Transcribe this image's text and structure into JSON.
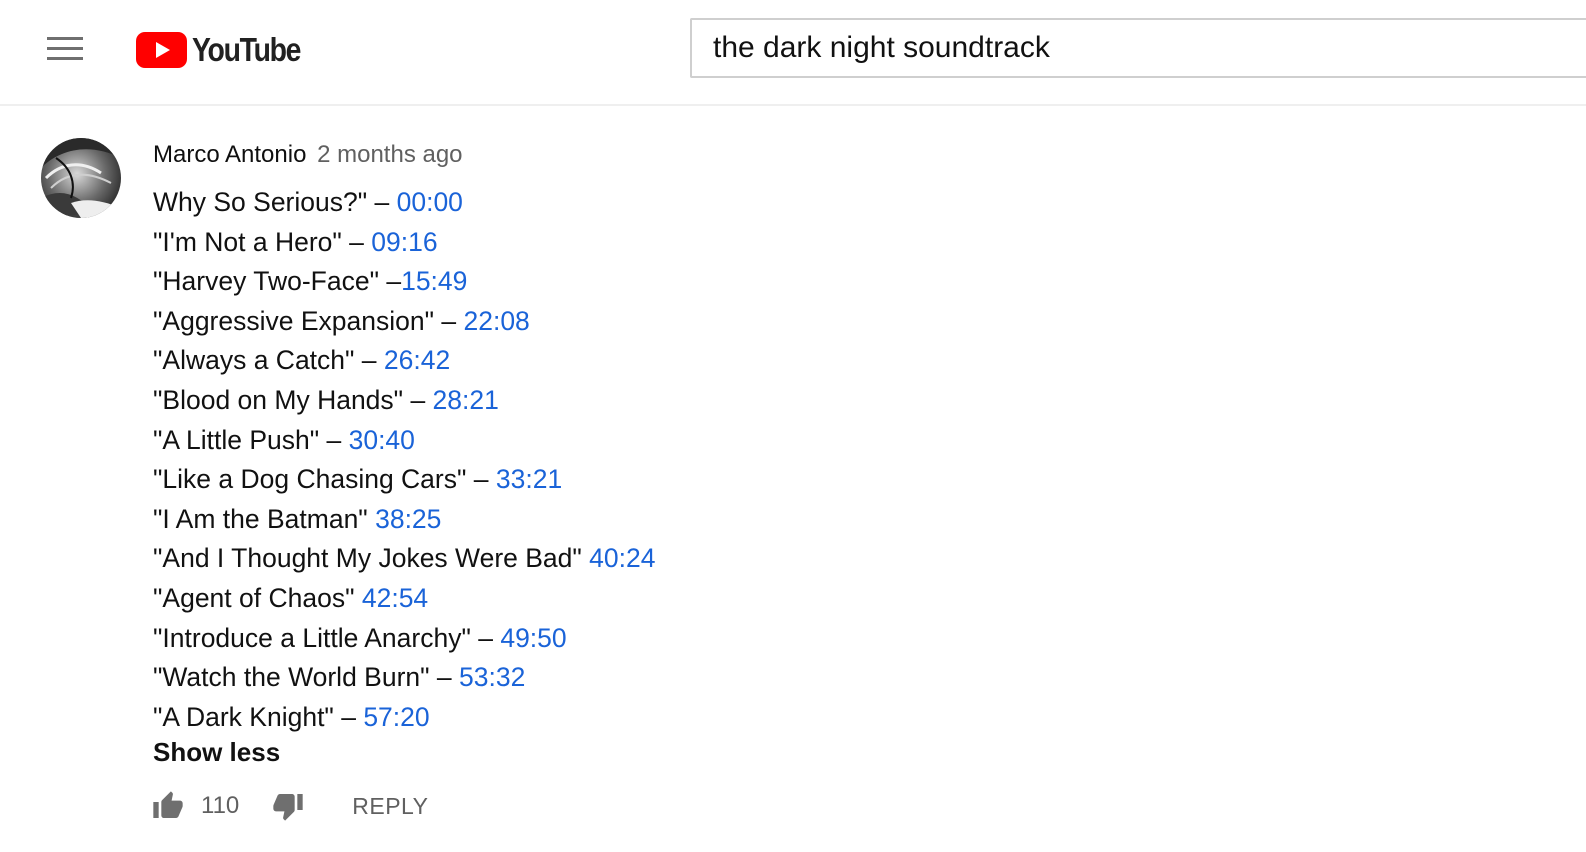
{
  "header": {
    "menu_icon": "hamburger-menu-icon",
    "logo_text": "YouTube",
    "brand_red": "#ff0000",
    "search_value": "the dark night soundtrack"
  },
  "comment": {
    "author": "Marco Antonio",
    "time": "2 months ago",
    "lines": [
      {
        "text": "Why So Serious?\" – ",
        "timestamp": "00:00"
      },
      {
        "text": "\"I'm Not a Hero\" – ",
        "timestamp": "09:16"
      },
      {
        "text": "\"Harvey Two-Face\" –",
        "timestamp": "15:49"
      },
      {
        "text": "\"Aggressive Expansion\" – ",
        "timestamp": "22:08"
      },
      {
        "text": "\"Always a Catch\" – ",
        "timestamp": "26:42"
      },
      {
        "text": "\"Blood on My Hands\" – ",
        "timestamp": "28:21"
      },
      {
        "text": "\"A Little Push\" – ",
        "timestamp": "30:40"
      },
      {
        "text": "\"Like a Dog Chasing Cars\" – ",
        "timestamp": "33:21"
      },
      {
        "text": "\"I Am the Batman\" ",
        "timestamp": "38:25"
      },
      {
        "text": "\"And I Thought My Jokes Were Bad\" ",
        "timestamp": "40:24"
      },
      {
        "text": "\"Agent of Chaos\" ",
        "timestamp": "42:54"
      },
      {
        "text": "\"Introduce a Little Anarchy\" – ",
        "timestamp": "49:50"
      },
      {
        "text": "\"Watch the World Burn\" – ",
        "timestamp": "53:32"
      },
      {
        "text": "\"A Dark Knight\" – ",
        "timestamp": "57:20"
      }
    ],
    "show_less": "Show less",
    "like_count": "110",
    "reply_label": "REPLY",
    "timestamp_color": "#1a63d8"
  }
}
